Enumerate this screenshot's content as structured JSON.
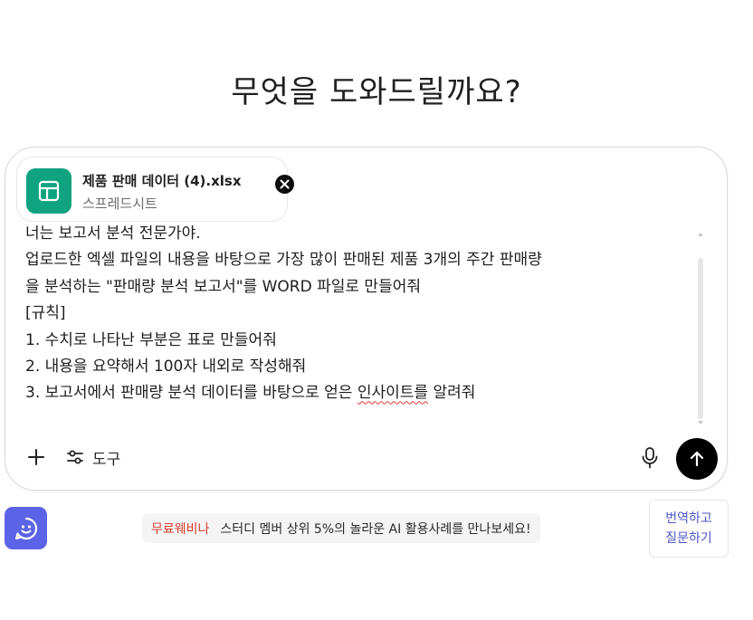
{
  "heading": "무엇을 도와드릴까요?",
  "attachment": {
    "name": "제품 판매 데이터 (4).xlsx",
    "type_label": "스프레드시트",
    "icon": "spreadsheet-icon",
    "icon_color": "#10a37f"
  },
  "prompt": {
    "lines": [
      {
        "text": "너는 보고서 분석 전문가야."
      },
      {
        "text": "업로드한 엑셀 파일의 내용을 바탕으로 가장 많이 판매된 제품 3개의 주간 판매량"
      },
      {
        "text": "을 분석하는 \"판매량 분석 보고서\"를 WORD 파일로 만들어줘"
      },
      {
        "text": "[규칙]"
      },
      {
        "text": "1. 수치로 나타난 부분은 표로 만들어줘"
      },
      {
        "text": "2. 내용을 요약해서 100자 내외로 작성해줘"
      },
      {
        "pre": "3. 보고서에서 판매량 분석 데이터를 바탕으로 얻은 ",
        "flagged": "인사이트를",
        "post": " 알려줘"
      }
    ]
  },
  "toolbar": {
    "add_icon": "plus-icon",
    "tools_icon": "sliders-icon",
    "tools_label": "도구",
    "mic_icon": "microphone-icon",
    "send_icon": "arrow-up-icon"
  },
  "footer": {
    "assistant_icon": "smile-chat-icon",
    "assistant_color": "#5b63e6",
    "promo_tag": "무료웨비나",
    "promo_text": "스터디 멤버 상위 5%의 놀라운 AI 활용사례를 만나보세요!",
    "translate_line1": "번역하고",
    "translate_line2": "질문하기"
  }
}
